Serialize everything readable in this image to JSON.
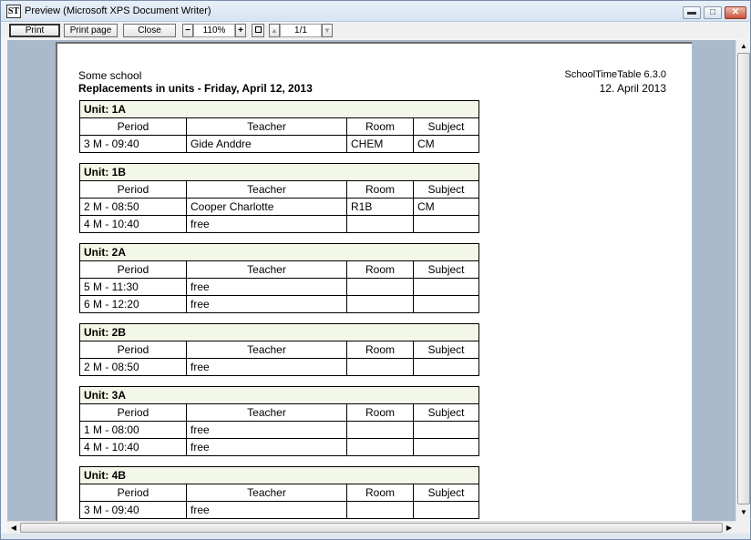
{
  "window": {
    "icon_text": "ST",
    "title": "Preview (Microsoft XPS Document Writer)",
    "minimize_glyph": "▬",
    "maximize_glyph": "□",
    "close_glyph": "✕"
  },
  "toolbar": {
    "print_label": "Print",
    "print_page_label": "Print page",
    "close_label": "Close",
    "zoom_out_label": "−",
    "zoom_value": "110%",
    "zoom_in_label": "+",
    "prev_page_glyph": "▲",
    "page_value": "1/1",
    "next_page_glyph": "▼"
  },
  "report": {
    "school": "Some school",
    "title": "Replacements in units  -  Friday, April 12, 2013",
    "app_version": "SchoolTimeTable 6.3.0",
    "date": "12. April 2013",
    "columns": {
      "period": "Period",
      "teacher": "Teacher",
      "room": "Room",
      "subject": "Subject"
    },
    "units": [
      {
        "name": "Unit: 1A",
        "rows": [
          {
            "period": "3 M - 09:40",
            "teacher": "Gide Anddre",
            "room": "CHEM",
            "subject": "CM"
          }
        ]
      },
      {
        "name": "Unit: 1B",
        "rows": [
          {
            "period": "2 M - 08:50",
            "teacher": "Cooper Charlotte",
            "room": "R1B",
            "subject": "CM"
          },
          {
            "period": "4 M - 10:40",
            "teacher": "free",
            "room": "",
            "subject": ""
          }
        ]
      },
      {
        "name": "Unit: 2A",
        "rows": [
          {
            "period": "5 M - 11:30",
            "teacher": "free",
            "room": "",
            "subject": ""
          },
          {
            "period": "6 M - 12:20",
            "teacher": "free",
            "room": "",
            "subject": ""
          }
        ]
      },
      {
        "name": "Unit: 2B",
        "rows": [
          {
            "period": "2 M - 08:50",
            "teacher": "free",
            "room": "",
            "subject": ""
          }
        ]
      },
      {
        "name": "Unit: 3A",
        "rows": [
          {
            "period": "1 M - 08:00",
            "teacher": "free",
            "room": "",
            "subject": ""
          },
          {
            "period": "4 M - 10:40",
            "teacher": "free",
            "room": "",
            "subject": ""
          }
        ]
      },
      {
        "name": "Unit: 4B",
        "rows": [
          {
            "period": "3 M - 09:40",
            "teacher": "free",
            "room": "",
            "subject": ""
          }
        ]
      }
    ]
  },
  "scrollbars": {
    "up_glyph": "▲",
    "down_glyph": "▼",
    "left_glyph": "◀",
    "right_glyph": "▶"
  }
}
